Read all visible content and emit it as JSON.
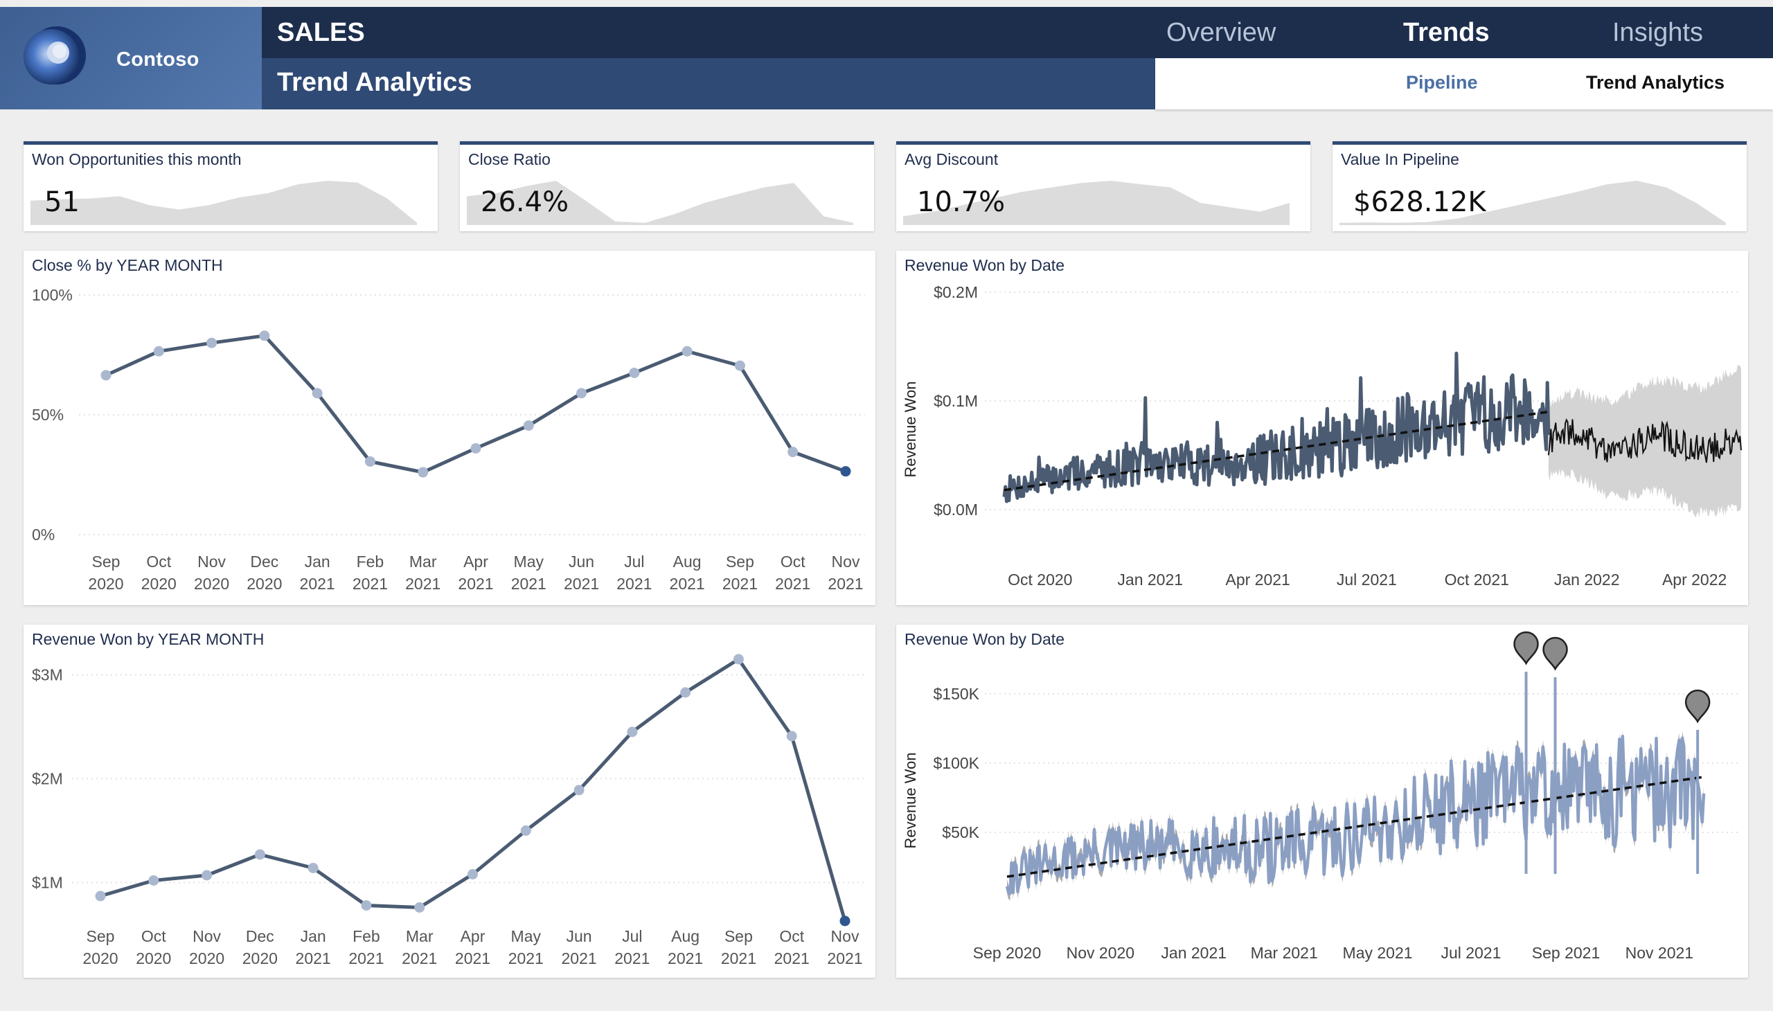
{
  "brand": {
    "name": "Contoso"
  },
  "header": {
    "title": "SALES",
    "subtitle": "Trend Analytics",
    "tabs": [
      {
        "label": "Overview",
        "active": false
      },
      {
        "label": "Trends",
        "active": true
      },
      {
        "label": "Insights",
        "active": false
      }
    ],
    "subtabs": [
      {
        "label": "Pipeline",
        "active": false
      },
      {
        "label": "Trend Analytics",
        "active": true
      }
    ]
  },
  "colors": {
    "navy": "#1c2e4c",
    "header_blue": "#2f4a75",
    "accent_link": "#4a6fa5",
    "line_dark": "#4a5b72",
    "marker_light": "#aab8cf",
    "marker_last": "#2e5690",
    "revenue_line": "#8b9fc3",
    "forecast_band": "#d4d4d4",
    "sparkline": "#dcdcdc"
  },
  "kpis": [
    {
      "title": "Won Opportunities this month",
      "value": "51",
      "trend": [
        0.55,
        0.58,
        0.6,
        0.65,
        0.45,
        0.35,
        0.45,
        0.62,
        0.72,
        0.92,
        1.0,
        0.96,
        0.6,
        0.05
      ]
    },
    {
      "title": "Close Ratio",
      "value": "26.4%",
      "trend": [
        0.65,
        0.72,
        0.88,
        1.0,
        0.55,
        0.08,
        0.05,
        0.25,
        0.5,
        0.68,
        0.85,
        0.95,
        0.2,
        0.05
      ]
    },
    {
      "title": "Avg Discount",
      "value": "10.7%",
      "trend": [
        0.2,
        0.3,
        0.45,
        0.6,
        0.75,
        0.85,
        0.95,
        1.0,
        0.92,
        0.85,
        0.5,
        0.4,
        0.3,
        0.5
      ]
    },
    {
      "title": "Value In Pipeline",
      "value": "$628.12K",
      "trend": [
        0.05,
        0.06,
        0.05,
        0.07,
        0.15,
        0.3,
        0.45,
        0.6,
        0.75,
        0.92,
        1.0,
        0.85,
        0.5,
        0.05
      ]
    }
  ],
  "chart_data": [
    {
      "id": "close_pct",
      "type": "line",
      "title": "Close % by YEAR MONTH",
      "categories": [
        [
          "Sep",
          "2020"
        ],
        [
          "Oct",
          "2020"
        ],
        [
          "Nov",
          "2020"
        ],
        [
          "Dec",
          "2020"
        ],
        [
          "Jan",
          "2021"
        ],
        [
          "Feb",
          "2021"
        ],
        [
          "Mar",
          "2021"
        ],
        [
          "Apr",
          "2021"
        ],
        [
          "May",
          "2021"
        ],
        [
          "Jun",
          "2021"
        ],
        [
          "Jul",
          "2021"
        ],
        [
          "Aug",
          "2021"
        ],
        [
          "Sep",
          "2021"
        ],
        [
          "Oct",
          "2021"
        ],
        [
          "Nov",
          "2021"
        ]
      ],
      "values": [
        66.5,
        76.5,
        80,
        83,
        59,
        30.5,
        26,
        36,
        45.5,
        59,
        67.5,
        76.5,
        70.5,
        34.5,
        26.4
      ],
      "y_ticks": [
        "0%",
        "50%",
        "100%"
      ],
      "y_tick_values": [
        0,
        50,
        100
      ],
      "ylim": [
        0,
        100
      ],
      "grid": true
    },
    {
      "id": "revenue_won_date_forecast",
      "type": "line",
      "title": "Revenue Won by Date",
      "ylabel": "Revenue Won",
      "x_ticks": [
        "Oct 2020",
        "Jan 2021",
        "Apr 2021",
        "Jul 2021",
        "Oct 2021",
        "Jan 2022",
        "Apr 2022"
      ],
      "x_range": [
        "2020-09-01",
        "2022-05-10"
      ],
      "y_ticks": [
        "$0.0M",
        "$0.1M",
        "$0.2M"
      ],
      "y_tick_values": [
        0,
        100000,
        200000
      ],
      "ylim": [
        0,
        200000
      ],
      "actual_range": [
        "2020-09-01",
        "2021-11-30"
      ],
      "forecast_range": [
        "2021-11-30",
        "2022-05-10"
      ],
      "trend": {
        "start": 18000,
        "end": 90000
      },
      "grid": true
    },
    {
      "id": "revenue_month",
      "type": "line",
      "title": "Revenue Won by YEAR MONTH",
      "categories": [
        [
          "Sep",
          "2020"
        ],
        [
          "Oct",
          "2020"
        ],
        [
          "Nov",
          "2020"
        ],
        [
          "Dec",
          "2020"
        ],
        [
          "Jan",
          "2021"
        ],
        [
          "Feb",
          "2021"
        ],
        [
          "Mar",
          "2021"
        ],
        [
          "Apr",
          "2021"
        ],
        [
          "May",
          "2021"
        ],
        [
          "Jun",
          "2021"
        ],
        [
          "Jul",
          "2021"
        ],
        [
          "Aug",
          "2021"
        ],
        [
          "Sep",
          "2021"
        ],
        [
          "Oct",
          "2021"
        ],
        [
          "Nov",
          "2021"
        ]
      ],
      "values": [
        0.87,
        1.02,
        1.07,
        1.27,
        1.14,
        0.78,
        0.76,
        1.08,
        1.5,
        1.89,
        2.45,
        2.83,
        3.15,
        2.41,
        0.63
      ],
      "y_ticks": [
        "$1M",
        "$2M",
        "$3M"
      ],
      "y_tick_values": [
        1,
        2,
        3
      ],
      "ylim": [
        0.35,
        3.35
      ],
      "grid": true
    },
    {
      "id": "revenue_won_date_anomaly",
      "type": "line",
      "title": "Revenue Won by Date",
      "ylabel": "Revenue Won",
      "x_ticks": [
        "Sep 2020",
        "Nov 2020",
        "Jan 2021",
        "Mar 2021",
        "May 2021",
        "Jul 2021",
        "Sep 2021",
        "Nov 2021"
      ],
      "x_range": [
        "2020-09-01",
        "2021-11-30"
      ],
      "y_ticks": [
        "$50K",
        "$100K",
        "$150K"
      ],
      "y_tick_values": [
        50000,
        100000,
        150000
      ],
      "ylim": [
        0,
        180000
      ],
      "trend": {
        "start": 18000,
        "end": 90000
      },
      "anomalies": [
        {
          "date": "2021-08-06",
          "value": 166000
        },
        {
          "date": "2021-08-25",
          "value": 162000
        },
        {
          "date": "2021-11-26",
          "value": 124000
        }
      ],
      "grid": true
    }
  ]
}
